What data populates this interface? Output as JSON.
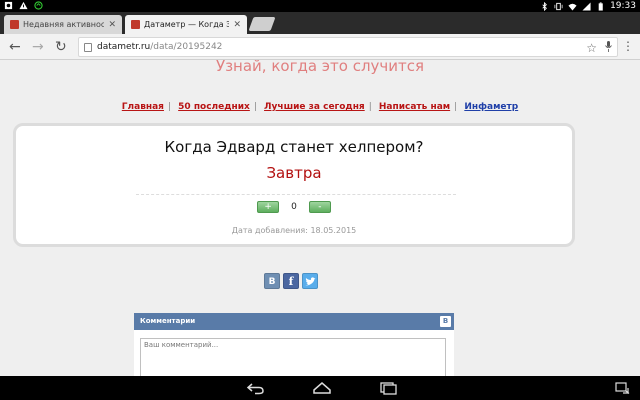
{
  "status_bar": {
    "time": "19:33",
    "left_icons": [
      "photo-notification-icon",
      "warning-icon",
      "sync-icon"
    ],
    "right_icons": [
      "bluetooth-icon",
      "vibrate-icon",
      "wifi-icon",
      "signal-icon",
      "battery-icon"
    ]
  },
  "tabs": [
    {
      "title": "Недавняя активность в Вк",
      "close": "✕",
      "favicon_color": "#c0392b",
      "active": false
    },
    {
      "title": "Датаметр — Когда Эдвард",
      "close": "✕",
      "favicon_color": "#c0392b",
      "active": true
    }
  ],
  "omnibox": {
    "host": "datametr.ru",
    "path": "/data/20195242"
  },
  "page": {
    "slogan": "Узнай, когда это случится",
    "nav": [
      {
        "label": "Главная",
        "color": "#b81414"
      },
      {
        "label": "50 последних",
        "color": "#b81414"
      },
      {
        "label": "Лучшие за сегодня",
        "color": "#b81414"
      },
      {
        "label": "Написать нам",
        "color": "#b81414"
      },
      {
        "label": "Инфаметр",
        "color": "#1f3fa8"
      }
    ],
    "question": "Когда Эдвард станет хелпером?",
    "answer": "Завтра",
    "votes": {
      "plus_label": "+",
      "minus_label": "-",
      "count": "0"
    },
    "date_added": "Дата добавления: 18.05.2015",
    "share": {
      "vk": "В",
      "fb": "f",
      "tw": "t"
    },
    "comments": {
      "header": "Комментарии",
      "vk_badge": "В",
      "placeholder": "Ваш комментарий..."
    }
  }
}
